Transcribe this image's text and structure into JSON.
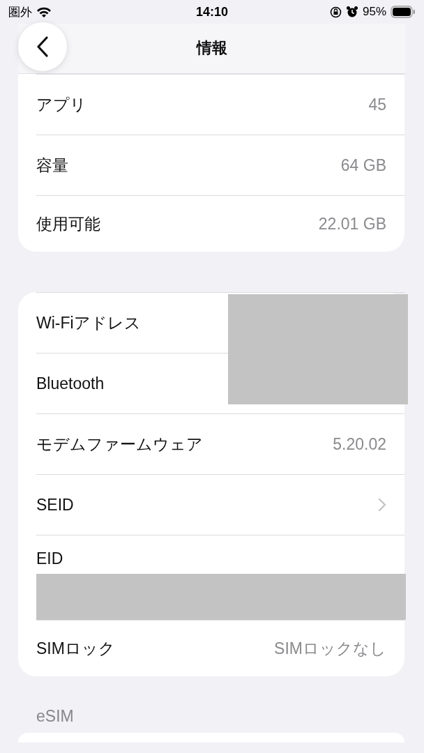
{
  "status_bar": {
    "carrier": "圏外",
    "time": "14:10",
    "battery": "95%"
  },
  "header": {
    "title": "情報"
  },
  "cards": [
    {
      "rows": [
        {
          "kind": "value",
          "label": "アプリ",
          "value": "45"
        },
        {
          "kind": "value",
          "label": "容量",
          "value": "64 GB"
        },
        {
          "kind": "value",
          "label": "使用可能",
          "value": "22.01 GB"
        }
      ]
    },
    {
      "rows": [
        {
          "kind": "redacted",
          "label": "Wi-Fiアドレス"
        },
        {
          "kind": "plain",
          "label": "Bluetooth"
        },
        {
          "kind": "value",
          "label": "モデムファームウェア",
          "value": "5.20.02"
        },
        {
          "kind": "link",
          "label": "SEID"
        },
        {
          "kind": "redacted_below",
          "label": "EID"
        },
        {
          "kind": "value",
          "label": "SIMロック",
          "value": "SIMロックなし"
        }
      ]
    }
  ],
  "section_header": "eSIM"
}
